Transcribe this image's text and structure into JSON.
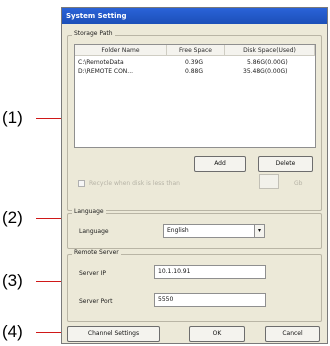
{
  "callouts": [
    "(1)",
    "(2)",
    "(3)",
    "(4)"
  ],
  "window": {
    "title": "System Setting"
  },
  "storage": {
    "group_title": "Storage Path",
    "columns": [
      "Folder Name",
      "Free Space",
      "Disk Space(Used)"
    ],
    "rows": [
      {
        "folder": "C:\\RemoteData",
        "free": "0.39G",
        "disk": "5.86G(0.00G)"
      },
      {
        "folder": "D:\\REMOTE CON...",
        "free": "0.88G",
        "disk": "35.48G(0.00G)"
      }
    ],
    "add_label": "Add",
    "delete_label": "Delete",
    "recycle_label": "Recycle when disk is less than",
    "recycle_unit": "Gb",
    "recycle_value": ""
  },
  "language": {
    "group_title": "Language",
    "label": "Language",
    "value": "English"
  },
  "remote": {
    "group_title": "Remote Server",
    "ip_label": "Server IP",
    "ip_value": "10.1.10.91",
    "port_label": "Server Port",
    "port_value": "5550"
  },
  "footer": {
    "channel_settings_label": "Channel Settings",
    "ok_label": "OK",
    "cancel_label": "Cancel"
  }
}
